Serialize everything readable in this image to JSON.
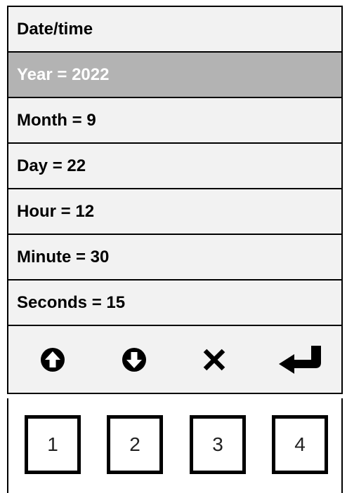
{
  "menu": {
    "title": "Date/time",
    "items": [
      {
        "label": "Year = 2022",
        "selected": true
      },
      {
        "label": "Month = 9",
        "selected": false
      },
      {
        "label": "Day = 22",
        "selected": false
      },
      {
        "label": "Hour = 12",
        "selected": false
      },
      {
        "label": "Minute = 30",
        "selected": false
      },
      {
        "label": "Seconds = 15",
        "selected": false
      }
    ]
  },
  "toolbar": {
    "icons": [
      "up-arrow-icon",
      "down-arrow-icon",
      "close-icon",
      "enter-icon"
    ]
  },
  "keys": [
    "1",
    "2",
    "3",
    "4"
  ],
  "colors": {
    "selected_bg": "#b3b3b3",
    "row_bg": "#f2f2f2",
    "border": "#000000"
  }
}
